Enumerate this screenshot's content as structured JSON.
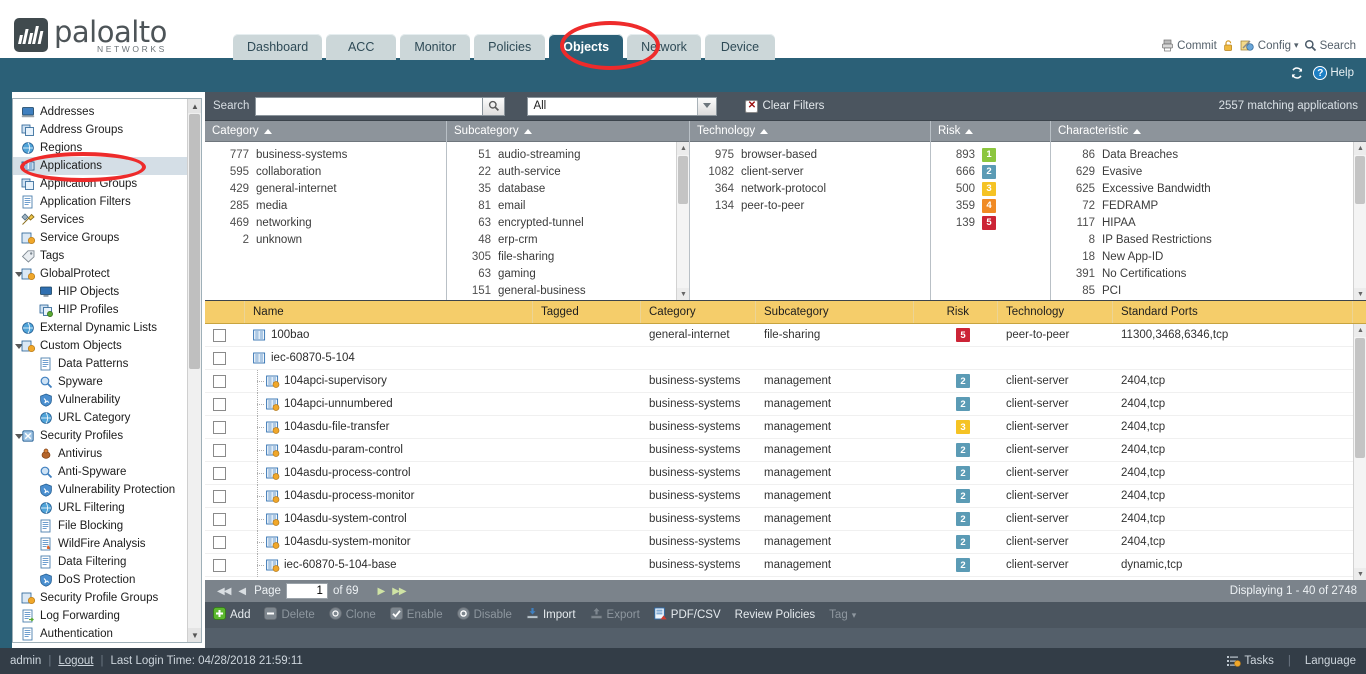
{
  "brand": {
    "name_line1": "paloalto",
    "name_line2": "NETWORKS",
    "trademark": "®"
  },
  "header": {
    "tabs": [
      {
        "label": "Dashboard",
        "active": false
      },
      {
        "label": "ACC",
        "active": false
      },
      {
        "label": "Monitor",
        "active": false
      },
      {
        "label": "Policies",
        "active": false
      },
      {
        "label": "Objects",
        "active": true
      },
      {
        "label": "Network",
        "active": false
      },
      {
        "label": "Device",
        "active": false
      }
    ],
    "actions": [
      {
        "label": "Commit",
        "icon": "commit-icon"
      },
      {
        "label": "",
        "icon": "lock-icon"
      },
      {
        "label": "Config",
        "icon": "config-icon",
        "caret": "▾"
      },
      {
        "label": "Search",
        "icon": "search-icon"
      }
    ],
    "refresh_icon": "refresh-icon",
    "help_label": "Help"
  },
  "sidebar": {
    "items": [
      {
        "label": "Addresses",
        "level": 1,
        "icon": "addresses-icon",
        "expandable": false,
        "selected": false
      },
      {
        "label": "Address Groups",
        "level": 1,
        "icon": "address-groups-icon",
        "expandable": false,
        "selected": false
      },
      {
        "label": "Regions",
        "level": 1,
        "icon": "regions-icon",
        "expandable": false,
        "selected": false
      },
      {
        "label": "Applications",
        "level": 1,
        "icon": "applications-icon",
        "expandable": false,
        "selected": true
      },
      {
        "label": "Application Groups",
        "level": 1,
        "icon": "application-groups-icon",
        "expandable": false,
        "selected": false
      },
      {
        "label": "Application Filters",
        "level": 1,
        "icon": "application-filters-icon",
        "expandable": false,
        "selected": false
      },
      {
        "label": "Services",
        "level": 1,
        "icon": "services-icon",
        "expandable": false,
        "selected": false
      },
      {
        "label": "Service Groups",
        "level": 1,
        "icon": "service-groups-icon",
        "expandable": false,
        "selected": false
      },
      {
        "label": "Tags",
        "level": 1,
        "icon": "tags-icon",
        "expandable": false,
        "selected": false
      },
      {
        "label": "GlobalProtect",
        "level": 1,
        "icon": "globalprotect-icon",
        "expandable": true,
        "selected": false
      },
      {
        "label": "HIP Objects",
        "level": 2,
        "icon": "hip-objects-icon",
        "expandable": false,
        "selected": false
      },
      {
        "label": "HIP Profiles",
        "level": 2,
        "icon": "hip-profiles-icon",
        "expandable": false,
        "selected": false
      },
      {
        "label": "External Dynamic Lists",
        "level": 1,
        "icon": "external-dynamic-lists-icon",
        "expandable": false,
        "selected": false
      },
      {
        "label": "Custom Objects",
        "level": 1,
        "icon": "custom-objects-icon",
        "expandable": true,
        "selected": false
      },
      {
        "label": "Data Patterns",
        "level": 2,
        "icon": "data-patterns-icon",
        "expandable": false,
        "selected": false
      },
      {
        "label": "Spyware",
        "level": 2,
        "icon": "spyware-icon",
        "expandable": false,
        "selected": false
      },
      {
        "label": "Vulnerability",
        "level": 2,
        "icon": "vulnerability-icon",
        "expandable": false,
        "selected": false
      },
      {
        "label": "URL Category",
        "level": 2,
        "icon": "url-category-icon",
        "expandable": false,
        "selected": false
      },
      {
        "label": "Security Profiles",
        "level": 1,
        "icon": "security-profiles-icon",
        "expandable": true,
        "selected": false
      },
      {
        "label": "Antivirus",
        "level": 2,
        "icon": "antivirus-icon",
        "expandable": false,
        "selected": false
      },
      {
        "label": "Anti-Spyware",
        "level": 2,
        "icon": "anti-spyware-icon",
        "expandable": false,
        "selected": false
      },
      {
        "label": "Vulnerability Protection",
        "level": 2,
        "icon": "vulnerability-protection-icon",
        "expandable": false,
        "selected": false
      },
      {
        "label": "URL Filtering",
        "level": 2,
        "icon": "url-filtering-icon",
        "expandable": false,
        "selected": false
      },
      {
        "label": "File Blocking",
        "level": 2,
        "icon": "file-blocking-icon",
        "expandable": false,
        "selected": false
      },
      {
        "label": "WildFire Analysis",
        "level": 2,
        "icon": "wildfire-analysis-icon",
        "expandable": false,
        "selected": false
      },
      {
        "label": "Data Filtering",
        "level": 2,
        "icon": "data-filtering-icon",
        "expandable": false,
        "selected": false
      },
      {
        "label": "DoS Protection",
        "level": 2,
        "icon": "dos-protection-icon",
        "expandable": false,
        "selected": false
      },
      {
        "label": "Security Profile Groups",
        "level": 1,
        "icon": "security-profile-groups-icon",
        "expandable": false,
        "selected": false
      },
      {
        "label": "Log Forwarding",
        "level": 1,
        "icon": "log-forwarding-icon",
        "expandable": false,
        "selected": false
      },
      {
        "label": "Authentication",
        "level": 1,
        "icon": "authentication-icon",
        "expandable": false,
        "selected": false
      }
    ]
  },
  "search": {
    "label": "Search",
    "value": "",
    "placeholder": "",
    "go_icon": "magnifier-icon",
    "filter_value": "All",
    "filter_options": [
      "All"
    ],
    "clear_filters_label": "Clear Filters",
    "match_count": "2557 matching applications"
  },
  "filters": {
    "columns": [
      {
        "title": "Category",
        "sort": "asc",
        "has_scroll": false,
        "rows": [
          {
            "count": "777",
            "label": "business-systems"
          },
          {
            "count": "595",
            "label": "collaboration"
          },
          {
            "count": "429",
            "label": "general-internet"
          },
          {
            "count": "285",
            "label": "media"
          },
          {
            "count": "469",
            "label": "networking"
          },
          {
            "count": "2",
            "label": "unknown"
          }
        ]
      },
      {
        "title": "Subcategory",
        "sort": "asc",
        "has_scroll": true,
        "rows": [
          {
            "count": "51",
            "label": "audio-streaming"
          },
          {
            "count": "22",
            "label": "auth-service"
          },
          {
            "count": "35",
            "label": "database"
          },
          {
            "count": "81",
            "label": "email"
          },
          {
            "count": "63",
            "label": "encrypted-tunnel"
          },
          {
            "count": "48",
            "label": "erp-crm"
          },
          {
            "count": "305",
            "label": "file-sharing"
          },
          {
            "count": "63",
            "label": "gaming"
          },
          {
            "count": "151",
            "label": "general-business"
          }
        ]
      },
      {
        "title": "Technology",
        "sort": "asc",
        "has_scroll": false,
        "rows": [
          {
            "count": "975",
            "label": "browser-based"
          },
          {
            "count": "1082",
            "label": "client-server"
          },
          {
            "count": "364",
            "label": "network-protocol"
          },
          {
            "count": "134",
            "label": "peer-to-peer"
          }
        ]
      },
      {
        "title": "Risk",
        "sort": "asc",
        "has_scroll": false,
        "rows": [
          {
            "count": "893",
            "badge": "1",
            "badge_color": "#8cc63e"
          },
          {
            "count": "666",
            "badge": "2",
            "badge_color": "#5b9bb5"
          },
          {
            "count": "500",
            "badge": "3",
            "badge_color": "#f5c324"
          },
          {
            "count": "359",
            "badge": "4",
            "badge_color": "#f08a24"
          },
          {
            "count": "139",
            "badge": "5",
            "badge_color": "#cc2436"
          }
        ]
      },
      {
        "title": "Characteristic",
        "sort": "asc",
        "has_scroll": true,
        "rows": [
          {
            "count": "86",
            "label": "Data Breaches"
          },
          {
            "count": "629",
            "label": "Evasive"
          },
          {
            "count": "625",
            "label": "Excessive Bandwidth"
          },
          {
            "count": "72",
            "label": "FEDRAMP"
          },
          {
            "count": "117",
            "label": "HIPAA"
          },
          {
            "count": "8",
            "label": "IP Based Restrictions"
          },
          {
            "count": "18",
            "label": "New App-ID"
          },
          {
            "count": "391",
            "label": "No Certifications"
          },
          {
            "count": "85",
            "label": "PCI"
          }
        ]
      }
    ]
  },
  "table": {
    "headers": [
      "",
      "Name",
      "Tagged",
      "Category",
      "Subcategory",
      "Risk",
      "Technology",
      "Standard Ports"
    ],
    "rows": [
      {
        "name": "100bao",
        "indent": 0,
        "icon": "application-icon",
        "tagged": "",
        "category": "general-internet",
        "subcategory": "file-sharing",
        "risk": "5",
        "risk_color": "#cc2436",
        "technology": "peer-to-peer",
        "ports": "11300,3468,6346,tcp"
      },
      {
        "name": "iec-60870-5-104",
        "indent": 0,
        "icon": "application-container-icon",
        "tagged": "",
        "category": "",
        "subcategory": "",
        "risk": "",
        "risk_color": "",
        "technology": "",
        "ports": ""
      },
      {
        "name": "104apci-supervisory",
        "indent": 1,
        "icon": "application-custom-icon",
        "tagged": "",
        "category": "business-systems",
        "subcategory": "management",
        "risk": "2",
        "risk_color": "#5b9bb5",
        "technology": "client-server",
        "ports": "2404,tcp"
      },
      {
        "name": "104apci-unnumbered",
        "indent": 1,
        "icon": "application-custom-icon",
        "tagged": "",
        "category": "business-systems",
        "subcategory": "management",
        "risk": "2",
        "risk_color": "#5b9bb5",
        "technology": "client-server",
        "ports": "2404,tcp"
      },
      {
        "name": "104asdu-file-transfer",
        "indent": 1,
        "icon": "application-custom-icon",
        "tagged": "",
        "category": "business-systems",
        "subcategory": "management",
        "risk": "3",
        "risk_color": "#f5c324",
        "technology": "client-server",
        "ports": "2404,tcp"
      },
      {
        "name": "104asdu-param-control",
        "indent": 1,
        "icon": "application-custom-icon",
        "tagged": "",
        "category": "business-systems",
        "subcategory": "management",
        "risk": "2",
        "risk_color": "#5b9bb5",
        "technology": "client-server",
        "ports": "2404,tcp"
      },
      {
        "name": "104asdu-process-control",
        "indent": 1,
        "icon": "application-custom-icon",
        "tagged": "",
        "category": "business-systems",
        "subcategory": "management",
        "risk": "2",
        "risk_color": "#5b9bb5",
        "technology": "client-server",
        "ports": "2404,tcp"
      },
      {
        "name": "104asdu-process-monitor",
        "indent": 1,
        "icon": "application-custom-icon",
        "tagged": "",
        "category": "business-systems",
        "subcategory": "management",
        "risk": "2",
        "risk_color": "#5b9bb5",
        "technology": "client-server",
        "ports": "2404,tcp"
      },
      {
        "name": "104asdu-system-control",
        "indent": 1,
        "icon": "application-custom-icon",
        "tagged": "",
        "category": "business-systems",
        "subcategory": "management",
        "risk": "2",
        "risk_color": "#5b9bb5",
        "technology": "client-server",
        "ports": "2404,tcp"
      },
      {
        "name": "104asdu-system-monitor",
        "indent": 1,
        "icon": "application-custom-icon",
        "tagged": "",
        "category": "business-systems",
        "subcategory": "management",
        "risk": "2",
        "risk_color": "#5b9bb5",
        "technology": "client-server",
        "ports": "2404,tcp"
      },
      {
        "name": "iec-60870-5-104-base",
        "indent": 1,
        "icon": "application-custom-icon",
        "tagged": "",
        "category": "business-systems",
        "subcategory": "management",
        "risk": "2",
        "risk_color": "#5b9bb5",
        "technology": "client-server",
        "ports": "dynamic,tcp"
      }
    ]
  },
  "pager": {
    "first_label": "◀◀",
    "prev_label": "◀",
    "page_label": "Page",
    "page_value": "1",
    "of_label": "of 69",
    "next_label": "▶",
    "last_label": "▶▶",
    "displaying": "Displaying 1 - 40 of 2748"
  },
  "toolbar": {
    "items": [
      {
        "label": "Add",
        "icon": "plus-icon",
        "enabled": true
      },
      {
        "label": "Delete",
        "icon": "minus-icon",
        "enabled": false
      },
      {
        "label": "Clone",
        "icon": "clone-icon",
        "enabled": false
      },
      {
        "label": "Enable",
        "icon": "check-icon",
        "enabled": false
      },
      {
        "label": "Disable",
        "icon": "disable-icon",
        "enabled": false
      },
      {
        "label": "Import",
        "icon": "import-icon",
        "enabled": true
      },
      {
        "label": "Export",
        "icon": "export-icon",
        "enabled": false
      },
      {
        "label": "PDF/CSV",
        "icon": "pdf-csv-icon",
        "enabled": true
      },
      {
        "label": "Review Policies",
        "icon": "",
        "enabled": true
      },
      {
        "label": "Tag",
        "icon": "",
        "enabled": false,
        "caret": "▾"
      }
    ]
  },
  "footer": {
    "user": "admin",
    "logout": "Logout",
    "last_login": "Last Login Time: 04/28/2018 21:59:11",
    "tasks": "Tasks",
    "language": "Language"
  },
  "colors": {
    "brand_blue": "#2b6077",
    "panel_dark": "#545f6a",
    "header_amber": "#f5cd6a",
    "annotation_red": "#ee2b2b"
  }
}
